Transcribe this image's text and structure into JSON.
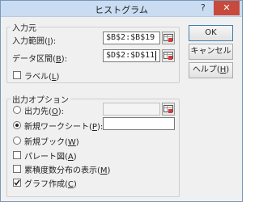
{
  "dialog": {
    "title": "ヒストグラム",
    "help_icon": "?",
    "close_icon": "✕"
  },
  "input_group": {
    "legend": "入力元",
    "input_range": {
      "label_pre": "入力範囲(",
      "mnemonic": "I",
      "label_post": "):",
      "value": "$B$2:$B$19"
    },
    "bin_range": {
      "label_pre": "データ区間(",
      "mnemonic": "B",
      "label_post": "):",
      "value": "$D$2:$D$11"
    },
    "labels": {
      "label_pre": "ラベル(",
      "mnemonic": "L",
      "label_post": ")",
      "checked": false
    }
  },
  "buttons": {
    "ok": "OK",
    "cancel": "キャンセル",
    "help_pre": "ヘルプ(",
    "help_mnemonic": "H",
    "help_post": ")"
  },
  "output_group": {
    "legend": "出力オプション",
    "output_range": {
      "label_pre": "出力先(",
      "mnemonic": "O",
      "label_post": "):",
      "selected": false,
      "value": ""
    },
    "new_sheet": {
      "label_pre": "新規ワークシート(",
      "mnemonic": "P",
      "label_post": "):",
      "selected": true,
      "value": ""
    },
    "new_book": {
      "label_pre": "新規ブック(",
      "mnemonic": "W",
      "label_post": ")",
      "selected": false
    },
    "pareto": {
      "label_pre": "パレート図(",
      "mnemonic": "A",
      "label_post": ")",
      "checked": false
    },
    "cumulative": {
      "label_pre": "累積度数分布の表示(",
      "mnemonic": "M",
      "label_post": ")",
      "checked": false
    },
    "chart": {
      "label_pre": "グラフ作成(",
      "mnemonic": "C",
      "label_post": ")",
      "checked": true
    }
  },
  "colors": {
    "titlebar": "#c9dcf1",
    "close": "#c74a3d",
    "accent": "#3c7fb1"
  }
}
